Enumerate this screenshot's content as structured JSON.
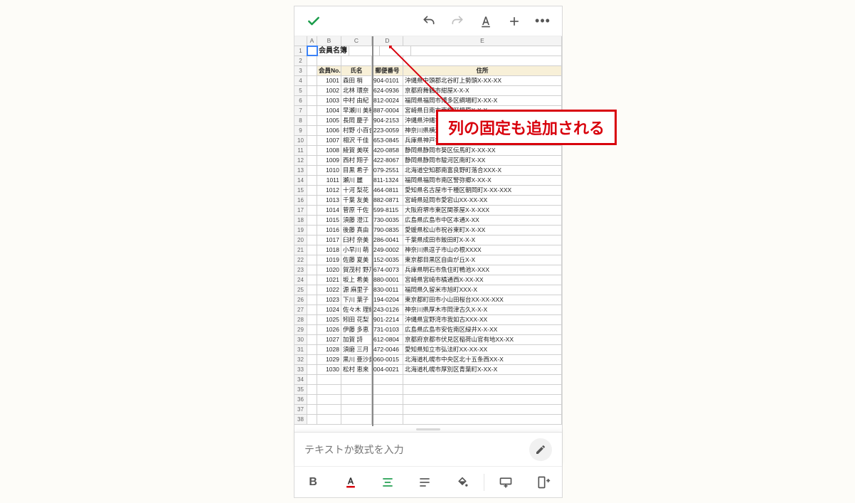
{
  "callout_text": "列の固定も追加される",
  "formula_placeholder": "テキストか数式を入力",
  "title_text": "会員名簿",
  "col_letters": [
    "A",
    "B",
    "C",
    "D",
    "E"
  ],
  "table_headers": {
    "b": "会員No.",
    "c": "氏名",
    "d": "郵便番号",
    "e": "住所"
  },
  "rows": [
    {
      "b": "1001",
      "c": "森田 梢",
      "d": "904-0101",
      "e": "沖縄県中頭郡北谷町上勢頭X-XX-XX"
    },
    {
      "b": "1002",
      "c": "北林 環奈",
      "d": "624-0936",
      "e": "京都府舞鶴市紺屋X-X-X"
    },
    {
      "b": "1003",
      "c": "中村 由紀",
      "d": "812-0024",
      "e": "福岡県福岡市博多区綱場町X-XX-X"
    },
    {
      "b": "1004",
      "c": "早瀬川 美樹",
      "d": "887-0004",
      "e": "宮崎県日南市南郷町榎原X-X-X"
    },
    {
      "b": "1005",
      "c": "長岡 慶子",
      "d": "904-2153",
      "e": "沖縄県沖縄市安慶田X-X-X"
    },
    {
      "b": "1006",
      "c": "村野 小百合",
      "d": "223-0059",
      "e": "神奈川県横浜市港北区北新横浜X-X-X"
    },
    {
      "b": "1007",
      "c": "相沢 千佳",
      "d": "653-0845",
      "e": "兵庫県神戸市長田区戸崎通X-X-X"
    },
    {
      "b": "1008",
      "c": "綾賀 美咲",
      "d": "420-0858",
      "e": "静岡県静岡市葵区伝馬町X-XX-XX"
    },
    {
      "b": "1009",
      "c": "西村 翔子",
      "d": "422-8067",
      "e": "静岡県静岡市駿河区南町X-XX"
    },
    {
      "b": "1010",
      "c": "目黒 希子",
      "d": "079-2551",
      "e": "北海道空知郡南富良野町落合XXX-X"
    },
    {
      "b": "1011",
      "c": "瀬川 麗",
      "d": "811-1324",
      "e": "福岡県福岡市南区警弥郷X-XX-X"
    },
    {
      "b": "1012",
      "c": "十河 梨花",
      "d": "464-0811",
      "e": "愛知県名古屋市千種区朝岡町X-XX-XXX"
    },
    {
      "b": "1013",
      "c": "千葉 友美",
      "d": "882-0871",
      "e": "宮崎県延岡市愛宕山XX-XX-XX"
    },
    {
      "b": "1014",
      "c": "菅原 千佐",
      "d": "599-8115",
      "e": "大阪府堺市東区関茶屋X-X-XXX"
    },
    {
      "b": "1015",
      "c": "須藤 澄江",
      "d": "730-0035",
      "e": "広島県広島市中区本通X-XX"
    },
    {
      "b": "1016",
      "c": "後藤 真由",
      "d": "790-0835",
      "e": "愛媛県松山市祝谷東町X-X-XX"
    },
    {
      "b": "1017",
      "c": "臼村 奈美",
      "d": "286-0041",
      "e": "千葉県成田市飯田町X-X-X"
    },
    {
      "b": "1018",
      "c": "小早川 萌",
      "d": "249-0002",
      "e": "神奈川県逗子市山の根XXXX"
    },
    {
      "b": "1019",
      "c": "佐藤 夏美",
      "d": "152-0035",
      "e": "東京都目黒区自由が丘X-X"
    },
    {
      "b": "1020",
      "c": "賀茂村 野乃香",
      "d": "674-0073",
      "e": "兵庫県明石市魚住町鴨池X-XXX"
    },
    {
      "b": "1021",
      "c": "坂上 希美",
      "d": "880-0001",
      "e": "宮崎県宮崎市橘通西X-XX-XX"
    },
    {
      "b": "1022",
      "c": "源 麻里子",
      "d": "830-0011",
      "e": "福岡県久留米市旭町XXX-X"
    },
    {
      "b": "1023",
      "c": "下川 葉子",
      "d": "194-0204",
      "e": "東京都町田市小山田桜台XX-XX-XXX"
    },
    {
      "b": "1024",
      "c": "佐々木 理絵",
      "d": "243-0126",
      "e": "神奈川県厚木市岡津古久X-X-X"
    },
    {
      "b": "1025",
      "c": "矧田 花梨",
      "d": "901-2214",
      "e": "沖縄県宜野湾市我如古XXX-XX"
    },
    {
      "b": "1026",
      "c": "伊藤 多恵",
      "d": "731-0103",
      "e": "広島県広島市安佐南区緑井X-X-XX"
    },
    {
      "b": "1027",
      "c": "加賀 詩",
      "d": "612-0804",
      "e": "京都府京都市伏見区稲荷山官有地XX-XX"
    },
    {
      "b": "1028",
      "c": "須磨 三月",
      "d": "472-0046",
      "e": "愛知県知立市弘法町XX-XX-XX"
    },
    {
      "b": "1029",
      "c": "黒川 亜沙美",
      "d": "060-0015",
      "e": "北海道札幌市中央区北十五条西XX-X"
    },
    {
      "b": "1030",
      "c": "松村 恵来",
      "d": "004-0021",
      "e": "北海道札幌市厚別区青葉町X-XX-X"
    }
  ],
  "blank_rows_after": 5,
  "icons": {
    "check": "check-icon",
    "undo": "undo-icon",
    "redo": "redo-icon",
    "text_format": "text-format-icon",
    "plus": "plus-icon",
    "more": "more-icon",
    "pencil": "pencil-icon",
    "bold": "bold-icon",
    "text_color": "text-color-icon",
    "align_center": "align-center-icon",
    "align_justify": "align-justify-icon",
    "fill": "fill-color-icon",
    "insert_row": "insert-row-icon",
    "insert_col": "insert-column-icon"
  }
}
